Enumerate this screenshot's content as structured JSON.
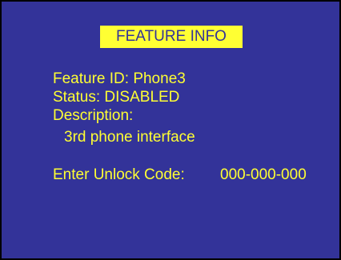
{
  "title": "FEATURE INFO",
  "feature_id": "Feature ID: Phone3",
  "status": "Status: DISABLED",
  "description_label": "Description:",
  "description_value": "3rd phone interface",
  "unlock_label": "Enter Unlock Code:",
  "unlock_code": "000-000-000",
  "colors": {
    "background": "#333399",
    "text": "#ffff33",
    "title_bg": "#ffff33",
    "title_text": "#333399",
    "border": "#000000"
  }
}
